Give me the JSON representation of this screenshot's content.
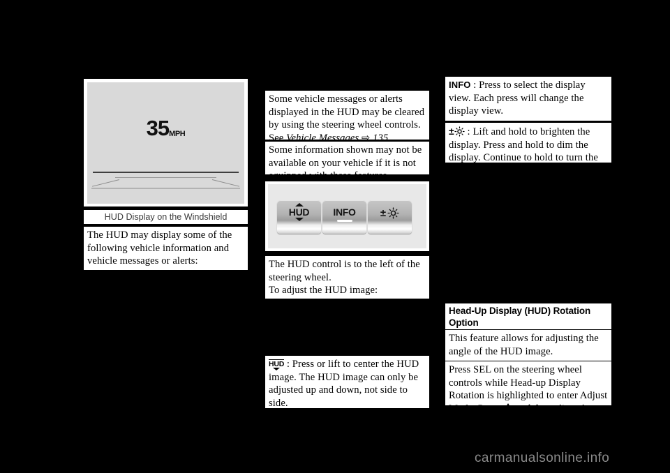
{
  "figure_left": {
    "speed_value": "35",
    "speed_unit": "MPH",
    "caption": "HUD Display on the Windshield"
  },
  "left_column": {
    "block1": "The HUD may display some of the following vehicle information and vehicle messages or alerts:"
  },
  "middle_column": {
    "block1_line1": "Some vehicle messages or alerts",
    "block1_line2": "displayed in the HUD may be cleared",
    "block1_line3": "by using the steering wheel controls.",
    "block1_line4_prefix": "See ",
    "block1_line4_italic": "Vehicle Messages",
    "block1_line4_page": "135",
    "block1_line4_suffix": ".",
    "block2": "Some information shown may not be available on your vehicle if it is not equipped with these features.",
    "controls": {
      "button_hud": "HUD",
      "button_info": "INFO",
      "button_brightness_plusminus": "±",
      "button_brightness_icon": "sun-icon"
    },
    "block3": "The HUD control is to the left of the steering wheel.",
    "block4": "To adjust the HUD image:",
    "block5_icon": "hud-icon",
    "block5": " : Press or lift to center the HUD image. The HUD image can only be adjusted up and down, not side to side."
  },
  "right_column": {
    "block1_label": "INFO",
    "block1": " : Press to select the display view. Each press will change the display view.",
    "block2_label": "±",
    "block2_icon": "sun-icon",
    "block2": " : Lift and hold to brighten the display. Press and hold to dim the display. Continue to hold to turn the display off.",
    "heading": "Head-Up Display (HUD) Rotation Option",
    "block3": "This feature allows for adjusting the angle of the HUD image.",
    "block4_part1": "Press SEL on the steering wheel controls while Head-up Display Rotation is highlighted to enter Adjust Mode. Press ",
    "block4_up_icon": "chevron-up-icon",
    "block4_or": " or ",
    "block4_down_icon": "chevron-down-icon",
    "block4_part2": " to adjust the"
  },
  "watermark": {
    "text": "carmanualsonline.info"
  },
  "colors": {
    "page_background": "#000000",
    "text_box_background": "#ffffff",
    "hud_image_background": "#d9d9d9",
    "caption_text": "#3a3a3a",
    "watermark_text": "#8a8a8a"
  }
}
